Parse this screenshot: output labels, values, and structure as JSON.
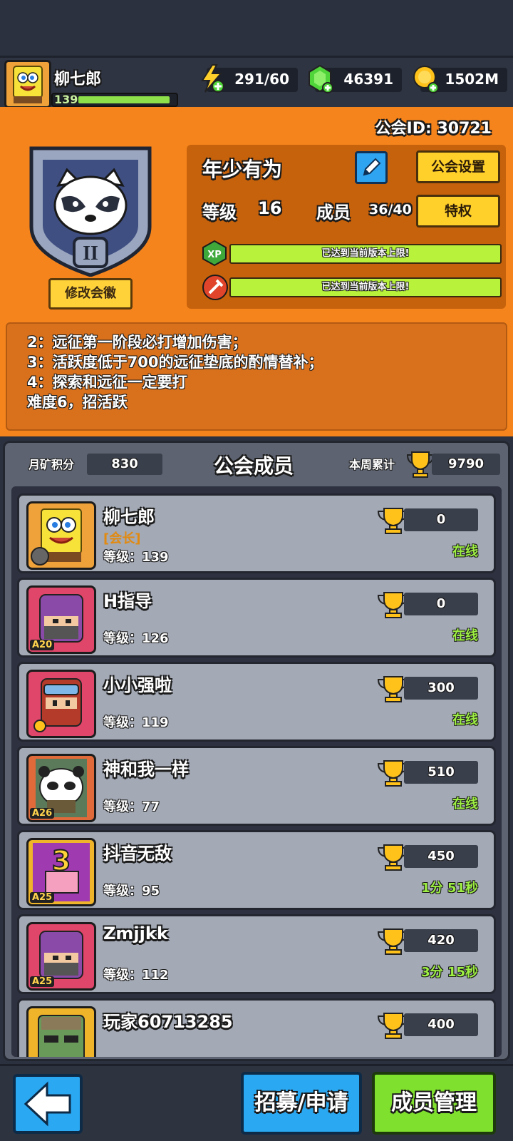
{
  "header": {
    "player_name": "柳七郎",
    "player_level": "139",
    "energy": "291/60",
    "gems": "46391",
    "gold": "1502M"
  },
  "guild": {
    "id_label": "公会ID: 30721",
    "name": "年少有为",
    "settings_label": "公会设置",
    "edit_emblem_label": "修改会徽",
    "level_label": "等级",
    "level": "16",
    "members_label": "成员",
    "members": "36/40",
    "privilege_label": "特权",
    "xp_status": "已达到当前版本上限!",
    "building_status": "已达到当前版本上限!",
    "xp_badge": "XP"
  },
  "notice": {
    "lines": [
      "2：远征第一阶段必打增加伤害；",
      "3：活跃度低于700的远征垫底的酌情替补；",
      "4：探索和远征一定要打",
      "难度6，招活跃"
    ]
  },
  "members_panel": {
    "month_label": "月矿积分",
    "month_value": "830",
    "title": "公会成员",
    "week_label": "本周累计",
    "week_value": "9790",
    "rows": [
      {
        "name": "柳七郎",
        "role": "[会长]",
        "level": "等级：139",
        "score": "0",
        "status": "在线"
      },
      {
        "name": "H指导",
        "level": "等级：126",
        "score": "0",
        "status": "在线",
        "badge": "A20"
      },
      {
        "name": "小小强啦",
        "level": "等级：119",
        "score": "300",
        "status": "在线"
      },
      {
        "name": "神和我一样",
        "level": "等级：77",
        "score": "510",
        "status": "在线",
        "badge": "A26"
      },
      {
        "name": "抖音无敌",
        "level": "等级：95",
        "score": "450",
        "status": "1分 51秒",
        "badge": "A25"
      },
      {
        "name": "Zmjjkk",
        "level": "等级：112",
        "score": "420",
        "status": "3分 15秒",
        "badge": "A25"
      },
      {
        "name": "玩家60713285",
        "level": "",
        "score": "400",
        "status": ""
      }
    ]
  },
  "bottom": {
    "recruit_label": "招募/申请",
    "manage_label": "成员管理"
  },
  "colors": {
    "orange_bg": "#f6841c",
    "online_green": "#9ef043",
    "accent_yellow": "#ffd02a",
    "accent_blue": "#2aa8f2"
  }
}
